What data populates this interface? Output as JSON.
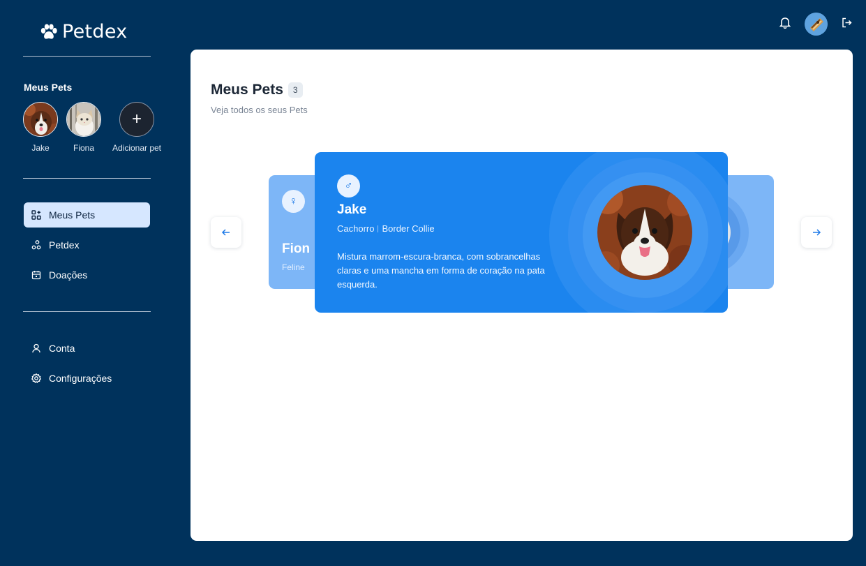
{
  "app": {
    "name": "Petdex"
  },
  "sidebar": {
    "pets_title": "Meus Pets",
    "pets": [
      {
        "name": "Jake"
      },
      {
        "name": "Fiona"
      }
    ],
    "add_pet_label": "Adicionar pet",
    "nav": [
      {
        "label": "Meus Pets",
        "icon": "grid-icon",
        "active": true
      },
      {
        "label": "Petdex",
        "icon": "nodes-icon"
      },
      {
        "label": "Doações",
        "icon": "calendar-icon"
      }
    ],
    "account_nav": [
      {
        "label": "Conta",
        "icon": "user-icon"
      },
      {
        "label": "Configurações",
        "icon": "gear-icon"
      }
    ]
  },
  "header": {
    "title": "Meus Pets",
    "count": "3",
    "subtitle": "Veja todos os seus Pets"
  },
  "carousel": {
    "prev_icon": "arrow-left-icon",
    "next_icon": "arrow-right-icon",
    "current": {
      "sex_symbol": "♂",
      "name": "Jake",
      "species": "Cachorro",
      "breed": "Border Collie",
      "description": "Mistura marrom-escura-branca, com sobrancelhas claras e uma mancha em forma de coração na pata esquerda."
    },
    "previous": {
      "sex_symbol": "♀",
      "name": "Fion",
      "species": "Feline"
    }
  },
  "colors": {
    "background": "#00325c",
    "card_blue": "#1b84ee",
    "card_light_blue": "#7db6f7",
    "active_nav": "#d6e7ff"
  }
}
